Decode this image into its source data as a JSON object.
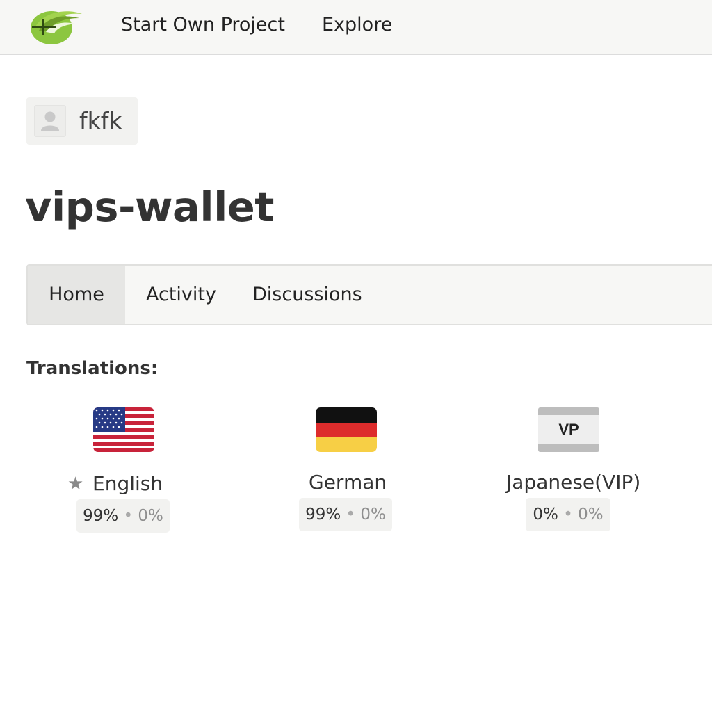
{
  "header": {
    "logo_icon": "transifex-style-wave-logo",
    "nav": [
      {
        "label": "Start Own Project"
      },
      {
        "label": "Explore"
      }
    ]
  },
  "owner": {
    "avatar_icon": "default-user-avatar-icon",
    "username": "fkfk"
  },
  "project": {
    "title": "vips-wallet"
  },
  "tabs": [
    {
      "label": "Home",
      "active": true
    },
    {
      "label": "Activity",
      "active": false
    },
    {
      "label": "Discussions",
      "active": false
    }
  ],
  "translations": {
    "label": "Translations:",
    "languages": [
      {
        "name": "English",
        "flag": "us-flag-icon",
        "source": true,
        "translated": "99%",
        "separator": "•",
        "reviewed": "0%"
      },
      {
        "name": "German",
        "flag": "de-flag-icon",
        "source": false,
        "translated": "99%",
        "separator": "•",
        "reviewed": "0%"
      },
      {
        "name": "Japanese(VIP)",
        "flag": "vp-flag-icon",
        "flag_code": "VP",
        "source": false,
        "translated": "0%",
        "separator": "•",
        "reviewed": "0%"
      }
    ]
  },
  "colors": {
    "header_bg": "#f7f7f5",
    "logo_green": "#8cc63f",
    "logo_dark": "#4a6b1e",
    "active_tab_bg": "#e6e6e4",
    "de_black": "#111111",
    "de_red": "#dd2c2c",
    "de_gold": "#f7cf45",
    "us_red": "#c8233a",
    "us_blue": "#273a85"
  }
}
